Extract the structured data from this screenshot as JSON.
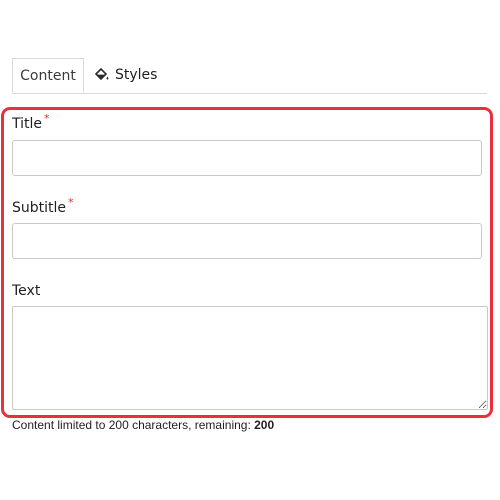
{
  "tabs": [
    {
      "label": "Content",
      "active": true
    },
    {
      "label": "Styles",
      "icon": "paint-bucket-icon",
      "active": false
    }
  ],
  "form": {
    "title": {
      "label": "Title",
      "required_mark": "*",
      "value": ""
    },
    "subtitle": {
      "label": "Subtitle",
      "required_mark": "*",
      "value": ""
    },
    "text": {
      "label": "Text",
      "value": ""
    }
  },
  "limit_note": {
    "prefix": "Content limited to 200 characters, remaining: ",
    "remaining": "200"
  },
  "colors": {
    "highlight": "#e8303f",
    "required": "#e03131",
    "border": "#c9c9c9"
  }
}
